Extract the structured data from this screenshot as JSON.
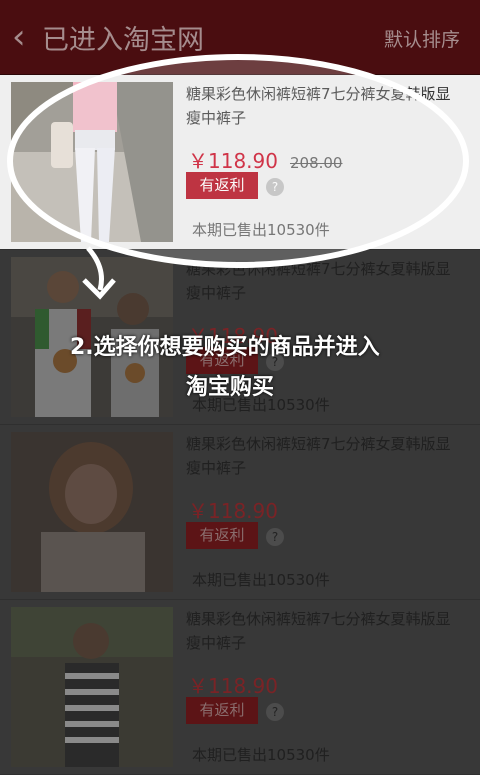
{
  "header": {
    "back_icon": "chevron-left-icon",
    "title": "已进入淘宝网",
    "sort_label": "默认排序"
  },
  "products": [
    {
      "name": "糖果彩色休闲裤短裤7七分裤女夏韩版显瘦中裤子",
      "price": "￥118.90",
      "original_price": "208.00",
      "rebate_label": "有返利",
      "help_icon": "?",
      "sold": "本期已售出10530件",
      "highlight": true
    },
    {
      "name": "糖果彩色休闲裤短裤7七分裤女夏韩版显瘦中裤子",
      "price": "￥118.90",
      "original_price": "",
      "rebate_label": "有返利",
      "help_icon": "?",
      "sold": "本期已售出10530件",
      "highlight": false
    },
    {
      "name": "糖果彩色休闲裤短裤7七分裤女夏韩版显瘦中裤子",
      "price": "￥118.90",
      "original_price": "",
      "rebate_label": "有返利",
      "help_icon": "?",
      "sold": "本期已售出10530件",
      "highlight": false
    },
    {
      "name": "糖果彩色休闲裤短裤7七分裤女夏韩版显瘦中裤子",
      "price": "￥118.90",
      "original_price": "",
      "rebate_label": "有返利",
      "help_icon": "?",
      "sold": "本期已售出10530件",
      "highlight": false
    }
  ],
  "tutorial": {
    "line1": "2.选择你想要购买的商品并进入",
    "line2": "淘宝购买"
  },
  "colors": {
    "header_bg": "#4a0d10",
    "price": "#c8001a",
    "rebate_bg": "#b10012"
  }
}
